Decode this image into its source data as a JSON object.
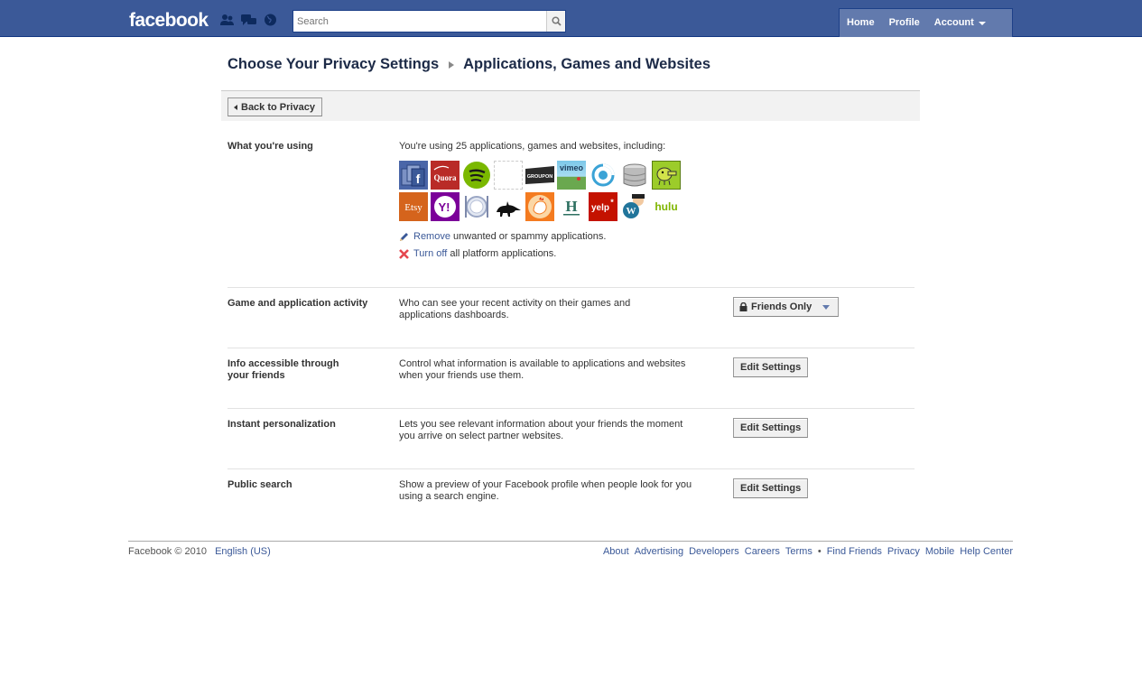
{
  "topbar": {
    "logo": "facebook",
    "search_placeholder": "Search",
    "nav": {
      "home": "Home",
      "profile": "Profile",
      "account": "Account"
    },
    "color": "#3b5998"
  },
  "header": {
    "crumb_parent": "Choose Your Privacy Settings",
    "crumb_current": "Applications, Games and Websites"
  },
  "back_button": "Back to Privacy",
  "using": {
    "label": "What you're using",
    "summary": "You're using 25 applications, games and websites, including:",
    "apps": [
      "Facebook Pages",
      "Quora",
      "Spotify",
      "Blank app",
      "Groupon",
      "Vimeo",
      "Circle app",
      "Barrel app",
      "Doodle Jump",
      "Etsy",
      "Yahoo!",
      "Dining app",
      "Aardvark",
      "Rooster app",
      "Huffington Post",
      "Yelp",
      "WordPress",
      "Hulu"
    ],
    "remove_link": "Remove",
    "remove_text": " unwanted or spammy applications.",
    "turnoff_link": "Turn off",
    "turnoff_text": " all platform applications."
  },
  "rows": [
    {
      "label": "Game and application activity",
      "desc": "Who can see your recent activity on their games and applications dashboards.",
      "control": "Friends Only"
    },
    {
      "label": "Info accessible through your friends",
      "desc": "Control what information is available to applications and websites when your friends use them.",
      "control": "Edit Settings"
    },
    {
      "label": "Instant personalization",
      "desc": "Lets you see relevant information about your friends the moment you arrive on select partner websites.",
      "control": "Edit Settings"
    },
    {
      "label": "Public search",
      "desc": "Show a preview of your Facebook profile when people look for you using a search engine.",
      "control": "Edit Settings"
    }
  ],
  "footer": {
    "copyright": "Facebook © 2010",
    "language": "English (US)",
    "links": [
      "About",
      "Advertising",
      "Developers",
      "Careers",
      "Terms",
      "•",
      "Find Friends",
      "Privacy",
      "Mobile",
      "Help Center"
    ]
  }
}
